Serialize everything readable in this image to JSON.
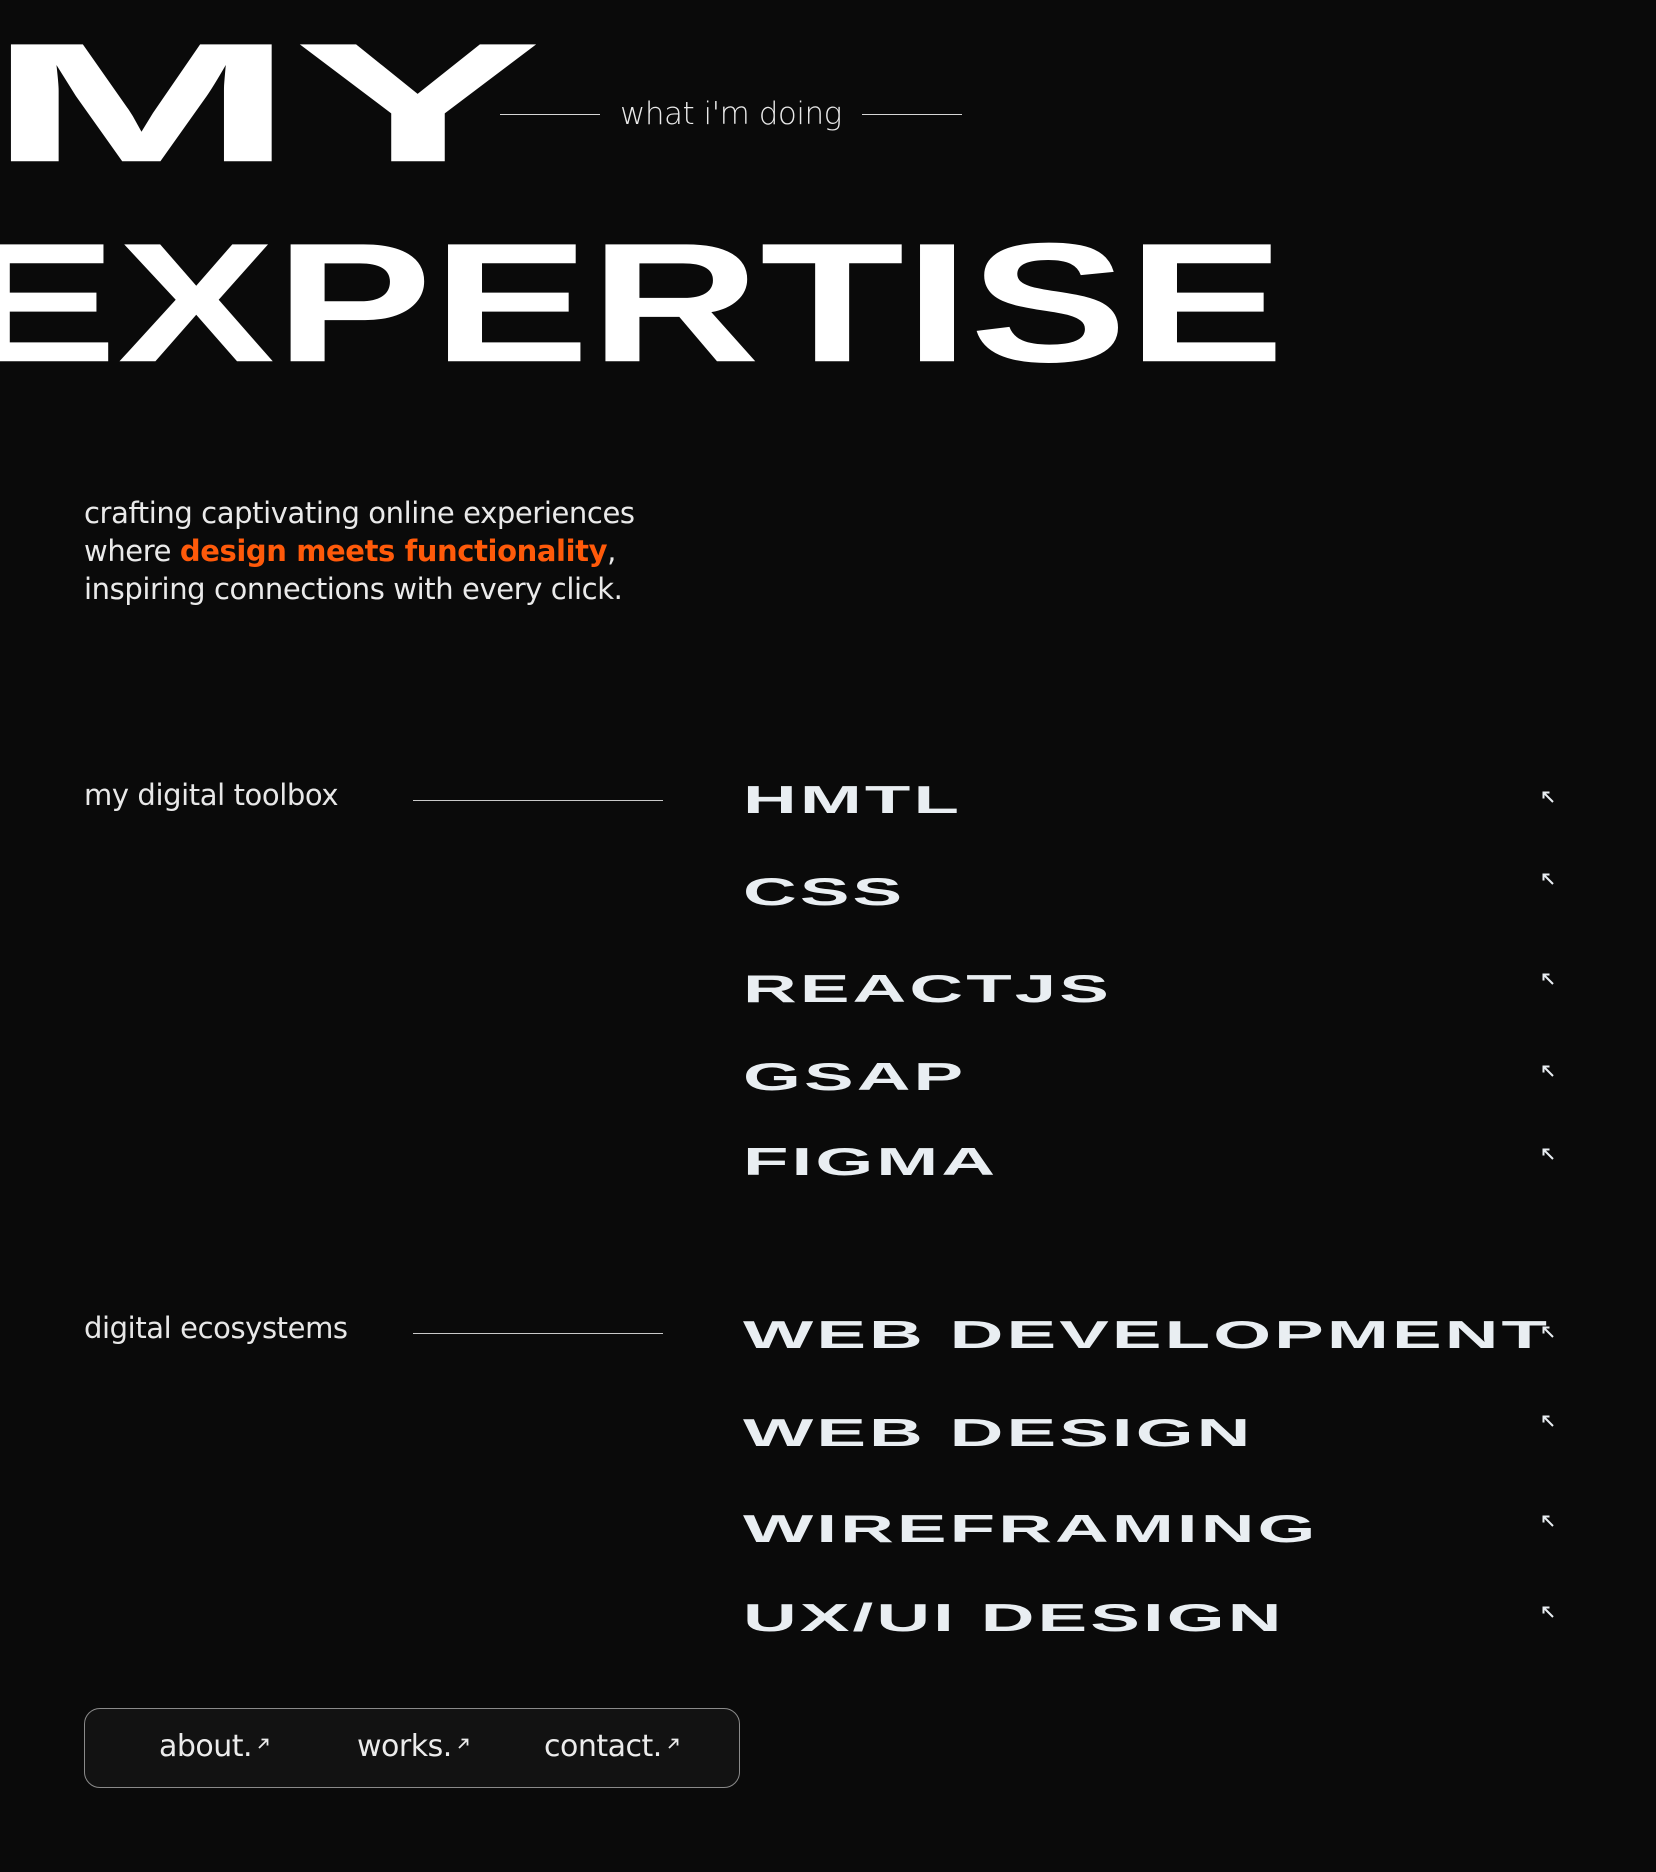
{
  "hero": {
    "line1": "MY",
    "line2": "EXPERTISE"
  },
  "kicker": {
    "text": "what i'm doing"
  },
  "tagline": {
    "line1": "crafting captivating online experiences",
    "line2_start": "where ",
    "highlight": "design meets functionality",
    "line2_end": ",",
    "line3": "inspiring connections with every click."
  },
  "toolbox": {
    "label": "my digital toolbox",
    "items": [
      {
        "label": "HMTL",
        "icon": "arrow-up-left-icon"
      },
      {
        "label": "CSS",
        "icon": "arrow-up-left-icon"
      },
      {
        "label": "REACTJS",
        "icon": "arrow-up-left-icon"
      },
      {
        "label": "GSAP",
        "icon": "arrow-up-left-icon"
      },
      {
        "label": "FIGMA",
        "icon": "arrow-up-left-icon"
      }
    ]
  },
  "ecosystems": {
    "label": "digital ecosystems",
    "items": [
      {
        "label": "WEB DEVELOPMENT",
        "icon": "arrow-up-left-icon"
      },
      {
        "label": "WEB DESIGN",
        "icon": "arrow-up-left-icon"
      },
      {
        "label": "WIREFRAMING",
        "icon": "arrow-up-left-icon"
      },
      {
        "label": "UX/UI DESIGN",
        "icon": "arrow-up-left-icon"
      }
    ]
  },
  "nav": {
    "about": "about.",
    "works": "works.",
    "contact": "contact.",
    "icon": "arrow-up-right-icon"
  },
  "colors": {
    "background": "#0a0a0a",
    "text": "#f1f1f1",
    "accent": "#ff5a0a"
  }
}
